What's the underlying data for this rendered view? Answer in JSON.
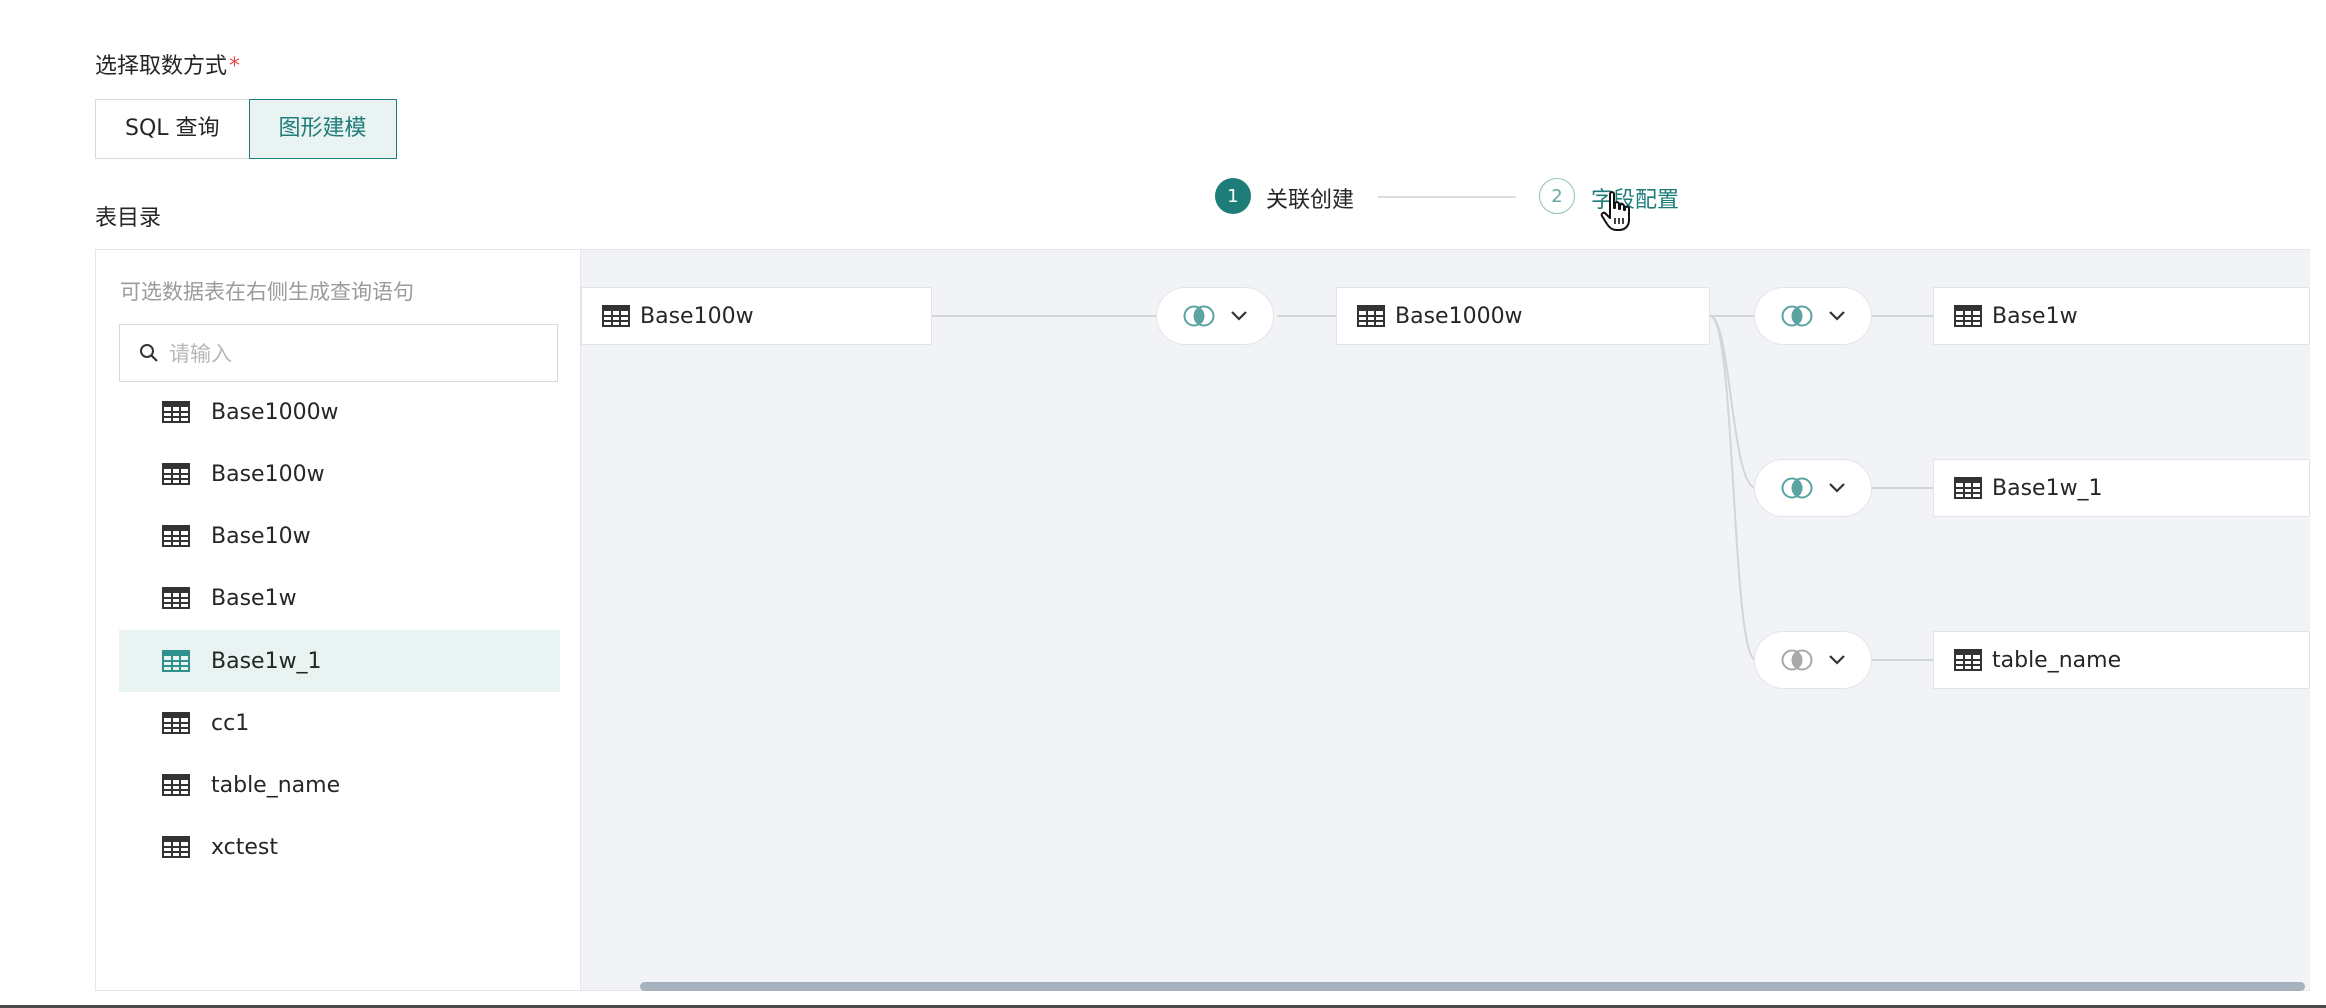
{
  "form": {
    "method_label": "选择取数方式",
    "required_mark": "*",
    "options": [
      "SQL 查询",
      "图形建模"
    ],
    "selected_option": "图形建模",
    "directory_label": "表目录"
  },
  "stepper": {
    "steps": [
      {
        "number": "1",
        "label": "关联创建",
        "state": "active"
      },
      {
        "number": "2",
        "label": "字段配置",
        "state": "pending"
      }
    ]
  },
  "sidebar": {
    "hint": "可选数据表在右侧生成查询语句",
    "search_placeholder": "请输入",
    "tables": [
      "Base1000w",
      "Base100w",
      "Base10w",
      "Base1w",
      "Base1w_1",
      "cc1",
      "table_name",
      "xctest"
    ],
    "selected_table": "Base1w_1"
  },
  "canvas": {
    "nodes": [
      "Base100w",
      "Base1000w",
      "Base1w",
      "Base1w_1",
      "table_name"
    ],
    "join_icons": [
      "venn-join-icon",
      "venn-join-icon",
      "venn-join-icon",
      "venn-join-icon"
    ]
  },
  "colors": {
    "accent": "#1e7c79",
    "accent_light": "#e9f3f2",
    "canvas_bg": "#f1f3f6",
    "border": "#d9d9d9",
    "required": "#e5484d"
  }
}
